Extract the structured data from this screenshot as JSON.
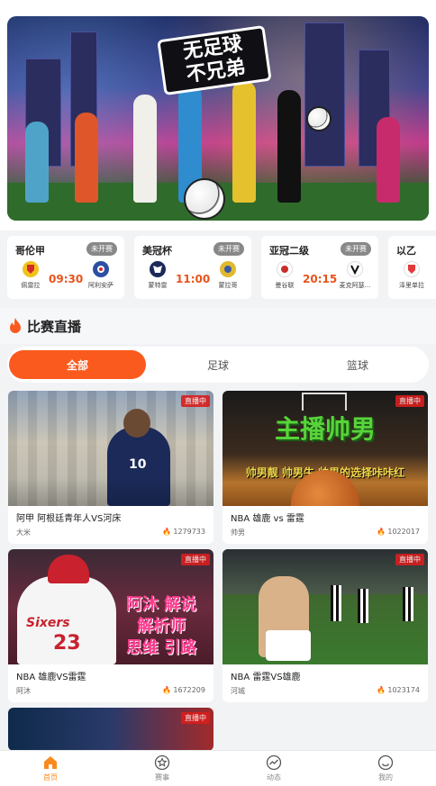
{
  "banner": {
    "title_line1": "无足球",
    "title_line2": "不兄弟"
  },
  "matches": [
    {
      "league": "哥伦甲",
      "status": "未开赛",
      "time": "09:30",
      "home": "佩雷拉",
      "away": "阿利安萨",
      "home_color": "#f0c21a",
      "away_color": "#2d4fa3"
    },
    {
      "league": "美冠杯",
      "status": "未开赛",
      "time": "11:00",
      "home": "蒙特雷",
      "away": "蒙拉哥",
      "home_color": "#1c2a5a",
      "away_color": "#e0b92e"
    },
    {
      "league": "亚冠二级",
      "status": "未开赛",
      "time": "20:15",
      "home": "曼谷联",
      "away": "麦克阿瑟...",
      "home_color": "#cc2b2b",
      "away_color": "#111111"
    },
    {
      "league": "以乙",
      "status": "",
      "time": "",
      "home": "泽里单拉",
      "away": "",
      "home_color": "#e23a3a",
      "away_color": "#ffffff"
    }
  ],
  "section": {
    "title": "比赛直播"
  },
  "tabs": [
    {
      "label": "全部",
      "active": true
    },
    {
      "label": "足球",
      "active": false
    },
    {
      "label": "篮球",
      "active": false
    }
  ],
  "streams": [
    {
      "title": "阿甲 阿根廷青年人VS河床",
      "host": "大米",
      "views": "1279733",
      "badge": "直播中"
    },
    {
      "title": "NBA 雄鹿 vs 雷霆",
      "host": "帅男",
      "views": "1022017",
      "badge": "直播中",
      "overlay_big": "主播帅男",
      "overlay_small": "帅男靓 帅男牛 帅男的选择咔咔红"
    },
    {
      "title": "NBA 雄鹿VS雷霆",
      "host": "阿沐",
      "views": "1672209",
      "badge": "直播中",
      "overlay_lines": [
        "阿沐 解说",
        "解析师",
        "思维 引路"
      ],
      "jersey_text": "Sixers",
      "jersey_number": "23"
    },
    {
      "title": "NBA 雷霆VS雄鹿",
      "host": "河城",
      "views": "1023174",
      "badge": "直播中"
    },
    {
      "title": "",
      "host": "",
      "views": "",
      "badge": "直播中"
    }
  ],
  "nav": [
    {
      "label": "首页",
      "icon": "home-icon",
      "active": true
    },
    {
      "label": "赛事",
      "icon": "star-icon",
      "active": false
    },
    {
      "label": "动态",
      "icon": "trend-icon",
      "active": false
    },
    {
      "label": "我的",
      "icon": "smile-icon",
      "active": false
    }
  ],
  "colors": {
    "accent": "#fb5a1e",
    "live": "#d81e1e",
    "nav_active": "#fb8a1e"
  }
}
